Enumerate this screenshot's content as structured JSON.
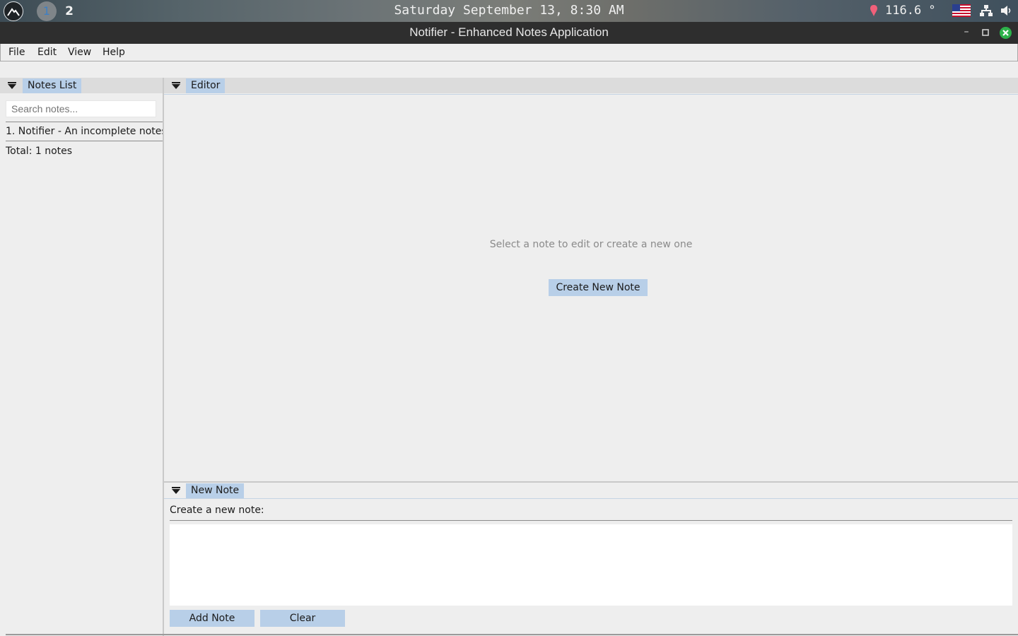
{
  "top_panel": {
    "workspace_1": "1",
    "workspace_2": "2",
    "clock": "Saturday September 13, 8:30 AM",
    "temperature": "116.6 °",
    "icons": [
      "launcher-icon",
      "temperature-icon",
      "us-flag-icon",
      "network-icon",
      "volume-icon"
    ]
  },
  "window": {
    "title": "Notifier - Enhanced Notes Application",
    "controls": [
      "minimize-icon",
      "maximize-icon",
      "close-icon"
    ]
  },
  "menu": {
    "file": "File",
    "edit": "Edit",
    "view": "View",
    "help": "Help"
  },
  "notes_list": {
    "tab_label": "Notes List",
    "search_placeholder": "Search notes...",
    "items": [
      {
        "label": "1. Notifier - An incomplete notes"
      }
    ],
    "total": "Total: 1 notes"
  },
  "editor": {
    "tab_label": "Editor",
    "placeholder": "Select a note to edit or create a new one",
    "create_button": "Create New Note"
  },
  "new_note": {
    "tab_label": "New Note",
    "prompt": "Create a new note:",
    "text_value": "",
    "add_button": "Add Note",
    "clear_button": "Clear"
  },
  "colors": {
    "tab_highlight": "#b8cfe8",
    "window_bg": "#eeeeee",
    "titlebar_bg": "#2e2e2e",
    "close_button": "#2db24a"
  }
}
